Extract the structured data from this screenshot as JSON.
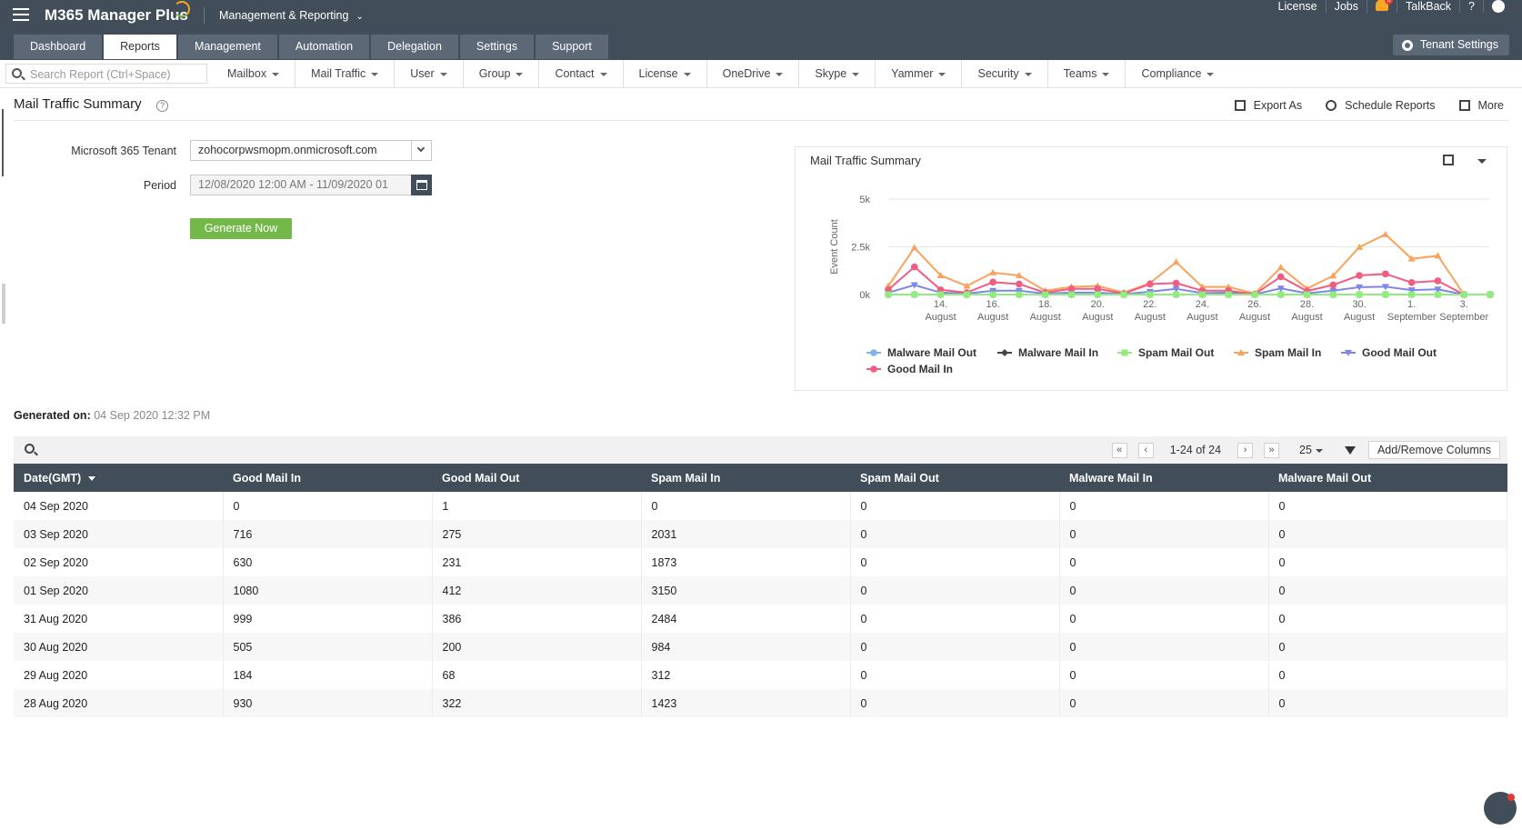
{
  "app": {
    "title": "M365 Manager Plus",
    "module": "Management & Reporting"
  },
  "toplinks": [
    "License",
    "Jobs",
    "TalkBack",
    "?"
  ],
  "notifications": {
    "count": "3"
  },
  "navtabs": [
    "Dashboard",
    "Reports",
    "Management",
    "Automation",
    "Delegation",
    "Settings",
    "Support"
  ],
  "active_tab": "Reports",
  "tenant_settings": "Tenant Settings",
  "search": {
    "placeholder": "Search Report (Ctrl+Space)"
  },
  "menus": [
    "Mailbox",
    "Mail Traffic",
    "User",
    "Group",
    "Contact",
    "License",
    "OneDrive",
    "Skype",
    "Yammer",
    "Security",
    "Teams",
    "Compliance"
  ],
  "report": {
    "title": "Mail Traffic Summary",
    "actions": {
      "export": "Export As",
      "schedule": "Schedule Reports",
      "more": "More"
    }
  },
  "form": {
    "tenant_label": "Microsoft 365 Tenant",
    "tenant_value": "zohocorpwsmopm.onmicrosoft.com",
    "period_label": "Period",
    "period_value": "12/08/2020 12:00 AM - 11/09/2020 01",
    "generate": "Generate Now"
  },
  "generated": {
    "label": "Generated on:",
    "value": "04 Sep 2020 12:32 PM"
  },
  "grid": {
    "page_info": "1-24 of 24",
    "page_size": "25",
    "add_remove": "Add/Remove Columns"
  },
  "table": {
    "columns": [
      "Date(GMT)",
      "Good Mail In",
      "Good Mail Out",
      "Spam Mail In",
      "Spam Mail Out",
      "Malware Mail In",
      "Malware Mail Out"
    ],
    "rows": [
      [
        "04 Sep 2020",
        "0",
        "1",
        "0",
        "0",
        "0",
        "0"
      ],
      [
        "03 Sep 2020",
        "716",
        "275",
        "2031",
        "0",
        "0",
        "0"
      ],
      [
        "02 Sep 2020",
        "630",
        "231",
        "1873",
        "0",
        "0",
        "0"
      ],
      [
        "01 Sep 2020",
        "1080",
        "412",
        "3150",
        "0",
        "0",
        "0"
      ],
      [
        "31 Aug 2020",
        "999",
        "386",
        "2484",
        "0",
        "0",
        "0"
      ],
      [
        "30 Aug 2020",
        "505",
        "200",
        "984",
        "0",
        "0",
        "0"
      ],
      [
        "29 Aug 2020",
        "184",
        "68",
        "312",
        "0",
        "0",
        "0"
      ],
      [
        "28 Aug 2020",
        "930",
        "322",
        "1423",
        "0",
        "0",
        "0"
      ]
    ]
  },
  "chart_data": {
    "type": "line",
    "title": "Mail Traffic Summary",
    "ylabel": "Event Count",
    "ylim": [
      0,
      5000
    ],
    "yticks": [
      "0k",
      "2.5k",
      "5k"
    ],
    "xticks": [
      [
        "14.",
        "August"
      ],
      [
        "16.",
        "August"
      ],
      [
        "18.",
        "August"
      ],
      [
        "20.",
        "August"
      ],
      [
        "22.",
        "August"
      ],
      [
        "24.",
        "August"
      ],
      [
        "26.",
        "August"
      ],
      [
        "28.",
        "August"
      ],
      [
        "30.",
        "August"
      ],
      [
        "1.",
        "September"
      ],
      [
        "3.",
        "September"
      ]
    ],
    "x": [
      "12 Aug",
      "13 Aug",
      "14 Aug",
      "15 Aug",
      "16 Aug",
      "17 Aug",
      "18 Aug",
      "19 Aug",
      "20 Aug",
      "21 Aug",
      "22 Aug",
      "23 Aug",
      "24 Aug",
      "25 Aug",
      "26 Aug",
      "27 Aug",
      "28 Aug",
      "29 Aug",
      "30 Aug",
      "31 Aug",
      "01 Sep",
      "02 Sep",
      "03 Sep",
      "04 Sep"
    ],
    "series": [
      {
        "name": "Malware Mail Out",
        "color": "#7cb5ec",
        "marker": "circle",
        "values": [
          0,
          0,
          0,
          0,
          0,
          0,
          0,
          0,
          0,
          0,
          0,
          0,
          0,
          0,
          0,
          0,
          0,
          0,
          0,
          0,
          0,
          0,
          0,
          0
        ]
      },
      {
        "name": "Malware Mail In",
        "color": "#434348",
        "marker": "diamond",
        "values": [
          0,
          0,
          0,
          0,
          0,
          0,
          0,
          0,
          0,
          0,
          0,
          0,
          0,
          0,
          0,
          0,
          0,
          0,
          0,
          0,
          0,
          0,
          0,
          0
        ]
      },
      {
        "name": "Spam Mail Out",
        "color": "#90ed7d",
        "marker": "square",
        "values": [
          0,
          0,
          0,
          0,
          0,
          0,
          0,
          0,
          0,
          0,
          0,
          0,
          0,
          0,
          0,
          0,
          0,
          0,
          0,
          0,
          0,
          0,
          0,
          0
        ]
      },
      {
        "name": "Spam Mail In",
        "color": "#f7a35c",
        "marker": "triangle",
        "values": [
          450,
          2450,
          1000,
          450,
          1150,
          1000,
          200,
          400,
          450,
          100,
          600,
          1700,
          400,
          400,
          50,
          1423,
          312,
          984,
          2484,
          3150,
          1873,
          2031,
          0,
          0
        ]
      },
      {
        "name": "Good Mail Out",
        "color": "#8085e9",
        "marker": "triangle-down",
        "values": [
          100,
          500,
          100,
          50,
          200,
          200,
          50,
          100,
          100,
          20,
          150,
          300,
          80,
          100,
          10,
          322,
          68,
          200,
          386,
          412,
          231,
          275,
          1,
          1
        ]
      },
      {
        "name": "Good Mail In",
        "color": "#f15c80",
        "marker": "circle",
        "values": [
          250,
          1450,
          250,
          100,
          650,
          550,
          100,
          300,
          300,
          50,
          550,
          600,
          200,
          200,
          20,
          930,
          184,
          505,
          999,
          1080,
          630,
          716,
          0,
          0
        ]
      }
    ],
    "legend": "bottom",
    "grid": true
  }
}
